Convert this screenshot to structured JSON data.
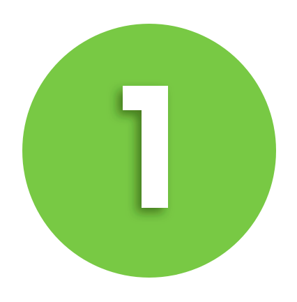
{
  "badge": {
    "number": "1",
    "circle_color": "#78c944",
    "number_color": "#ffffff",
    "shadow_color": "#1e3d0a"
  }
}
